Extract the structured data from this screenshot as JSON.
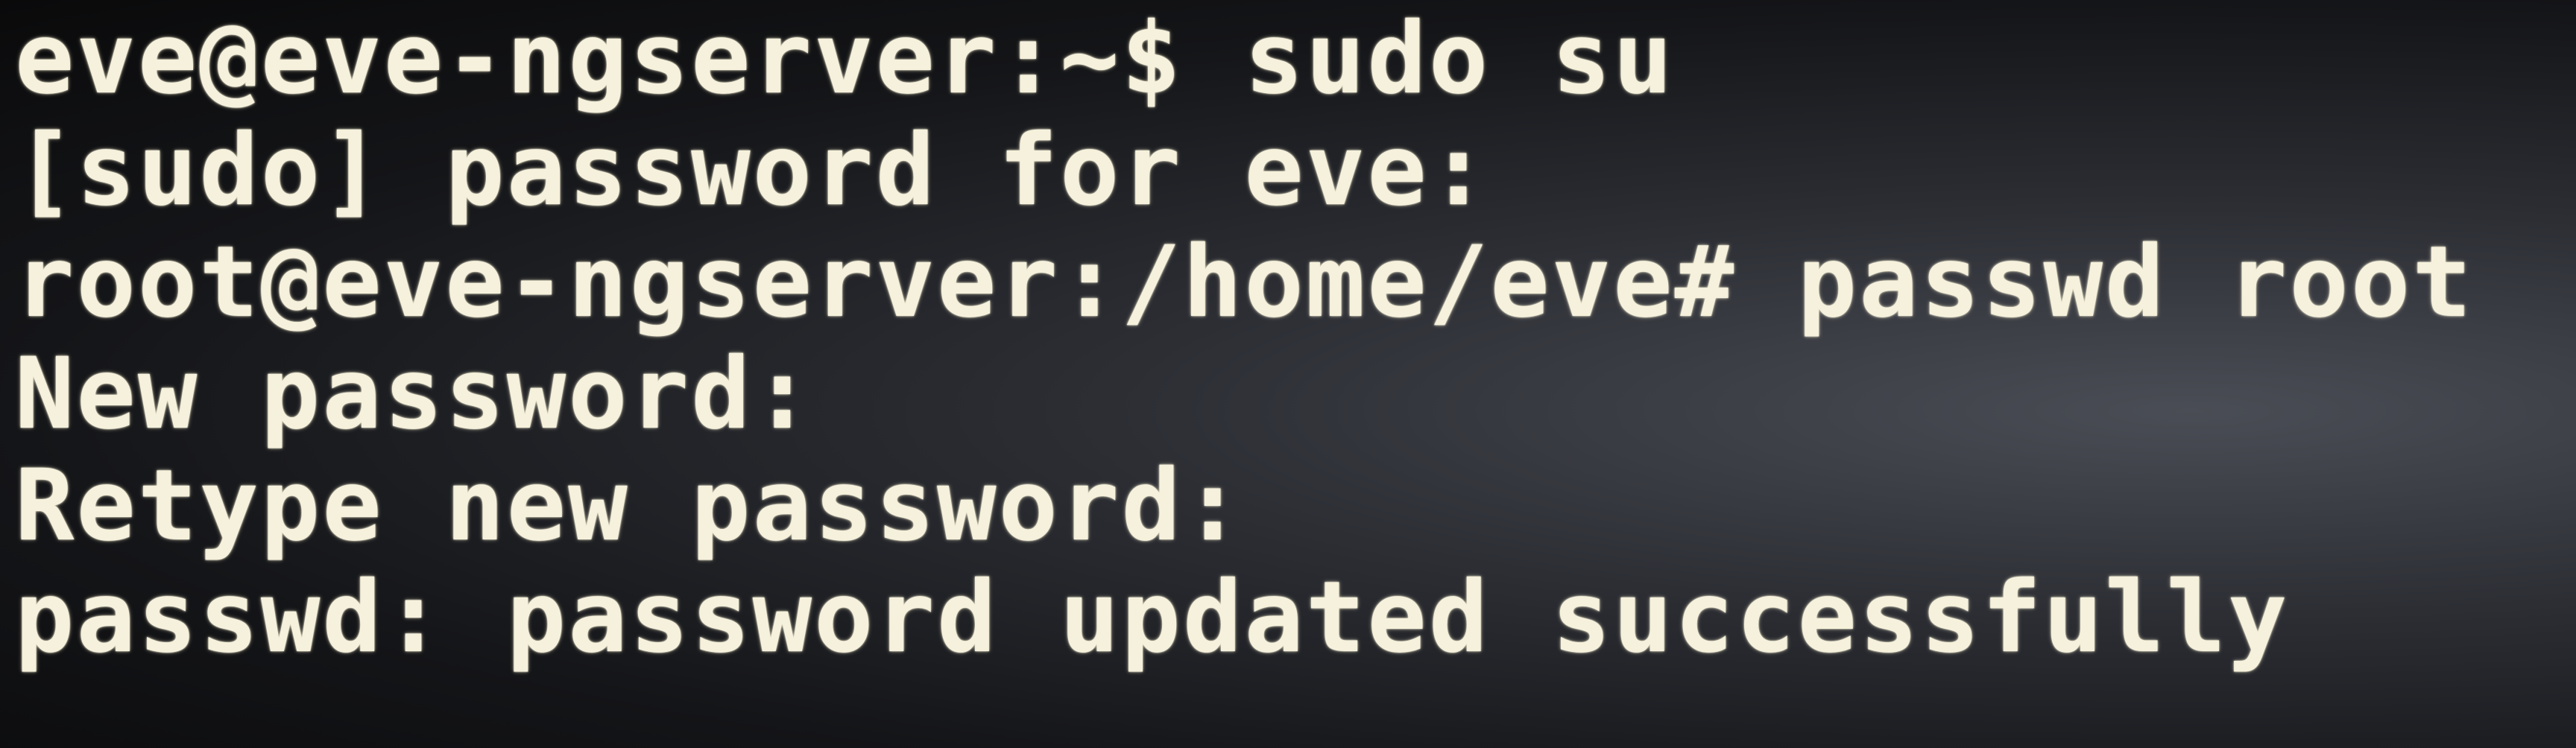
{
  "terminal": {
    "lines": [
      "eve@eve-ngserver:~$ sudo su",
      "[sudo] password for eve:",
      "root@eve-ngserver:/home/eve# passwd root",
      "New password:",
      "Retype new password:",
      "passwd: password updated successfully"
    ],
    "colors": {
      "text": "#f6f1dc",
      "background": "#141518"
    }
  }
}
